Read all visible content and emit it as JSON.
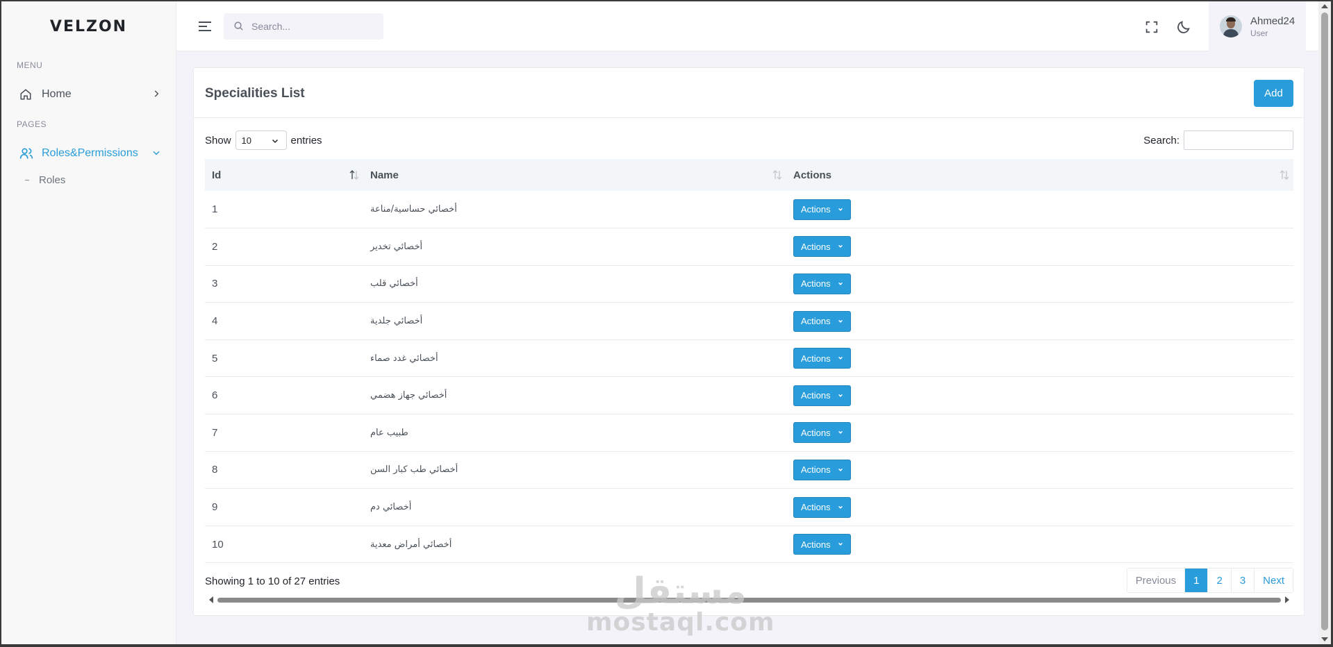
{
  "brand": {
    "logo_text": "VELZON"
  },
  "sidebar": {
    "menu_title": "MENU",
    "pages_title": "PAGES",
    "items": [
      {
        "label": "Home",
        "icon": "home-icon"
      },
      {
        "label": "Roles&Permissions",
        "icon": "users-icon",
        "expanded": true
      }
    ],
    "sub_items": [
      {
        "label": "Roles"
      }
    ]
  },
  "topbar": {
    "search_placeholder": "Search...",
    "user": {
      "name": "Ahmed24",
      "role": "User"
    }
  },
  "card": {
    "title": "Specialities List",
    "add_label": "Add",
    "show_label": "Show",
    "entries_label": "entries",
    "page_length": "10",
    "search_label": "Search:",
    "search_value": "",
    "columns": [
      "Id",
      "Name",
      "Actions"
    ],
    "rows": [
      {
        "id": "1",
        "name": "أخصائي حساسية/مناعة",
        "action": "Actions"
      },
      {
        "id": "2",
        "name": "أخصائي تخدير",
        "action": "Actions"
      },
      {
        "id": "3",
        "name": "أخصائي قلب",
        "action": "Actions"
      },
      {
        "id": "4",
        "name": "أخصائي جلدية",
        "action": "Actions"
      },
      {
        "id": "5",
        "name": "أخصائي غدد صماء",
        "action": "Actions"
      },
      {
        "id": "6",
        "name": "أخصائي جهاز هضمي",
        "action": "Actions"
      },
      {
        "id": "7",
        "name": "طبيب عام",
        "action": "Actions"
      },
      {
        "id": "8",
        "name": "أخصائي طب كبار السن",
        "action": "Actions"
      },
      {
        "id": "9",
        "name": "أخصائي دم",
        "action": "Actions"
      },
      {
        "id": "10",
        "name": "أخصائي أمراض معدية",
        "action": "Actions"
      }
    ],
    "info": "Showing 1 to 10 of 27 entries",
    "pagination": {
      "previous": "Previous",
      "pages": [
        "1",
        "2",
        "3"
      ],
      "current": "1",
      "next": "Next"
    }
  },
  "watermark": {
    "arabic": "مستقل",
    "latin": "mostaql.com"
  },
  "colors": {
    "accent": "#299cdb",
    "background": "#f3f3f9"
  }
}
